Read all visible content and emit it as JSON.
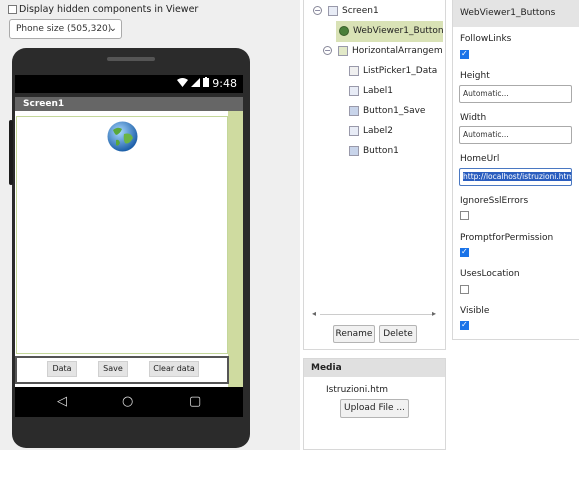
{
  "viewer": {
    "hidden_label": "Display hidden components in Viewer",
    "phone_size": "Phone size (505,320)",
    "status_time": "9:48",
    "screen_title": "Screen1",
    "buttons": [
      "Data",
      "Save",
      "Clear data"
    ]
  },
  "tree": {
    "items": [
      {
        "label": "Screen1"
      },
      {
        "label": "WebViewer1_Buttons"
      },
      {
        "label": "HorizontalArrangement"
      },
      {
        "label": "ListPicker1_Data"
      },
      {
        "label": "Label1"
      },
      {
        "label": "Button1_Save"
      },
      {
        "label": "Label2"
      },
      {
        "label": "Button1"
      }
    ],
    "rename_label": "Rename",
    "delete_label": "Delete"
  },
  "media": {
    "title": "Media",
    "file": "Istruzioni.htm",
    "upload_label": "Upload File ..."
  },
  "properties": {
    "title": "WebViewer1_Buttons",
    "follow_links_label": "FollowLinks",
    "follow_links": true,
    "height_label": "Height",
    "height_value": "Automatic...",
    "width_label": "Width",
    "width_value": "Automatic...",
    "home_url_label": "HomeUrl",
    "home_url_value": "http://localhost/istruzioni.htm",
    "ignore_ssl_label": "IgnoreSslErrors",
    "ignore_ssl": false,
    "prompt_label": "PromptforPermission",
    "prompt": true,
    "location_label": "UsesLocation",
    "location": false,
    "visible_label": "Visible",
    "visible": true
  },
  "colors": {
    "selected_bg": "#d9e2b6",
    "checkbox_on": "#1a73e8"
  }
}
